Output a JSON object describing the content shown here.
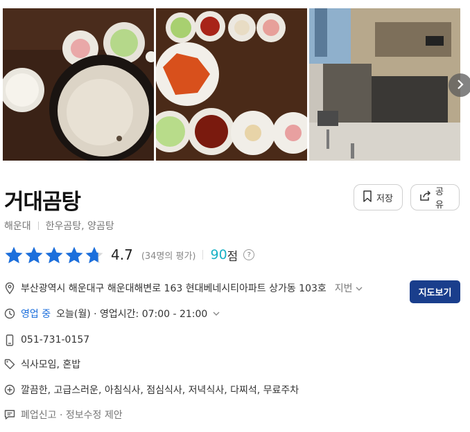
{
  "place": {
    "name": "거대곰탕",
    "area": "해운대",
    "categories": "한우곰탕, 양곰탕",
    "rating": "4.7",
    "rating_stars": 4.7,
    "reviews": "(34명의 평가)",
    "score": "90",
    "score_unit": "점",
    "help": "?"
  },
  "actions": {
    "save_label": "저장",
    "share_label": "공유",
    "map_label": "지도보기"
  },
  "info": {
    "address": "부산광역시 해운대구 해운대해변로 163 현대베네시티아파트 상가동 103호",
    "address_more": "지번",
    "status": "영업 중",
    "hours": "오늘(월) · 영업시간: 07:00 - 21:00",
    "phone": "051-731-0157",
    "tags": "식사모임, 혼밥",
    "features": "깔끔한, 고급스러운, 아침식사, 점심식사, 저녁식사, 다찌석, 무료주차",
    "report": "폐업신고 · 정보수정 제안"
  },
  "colors": {
    "accent": "#1a3e8c",
    "star": "#1c6fdc",
    "open": "#1c6fdc",
    "score": "#1ab2c5"
  },
  "icons": [
    "chevron-right-icon",
    "bookmark-icon",
    "share-icon",
    "star-icon",
    "pin-icon",
    "clock-icon",
    "phone-icon",
    "tag-icon",
    "plus-circle-icon",
    "chat-icon"
  ]
}
